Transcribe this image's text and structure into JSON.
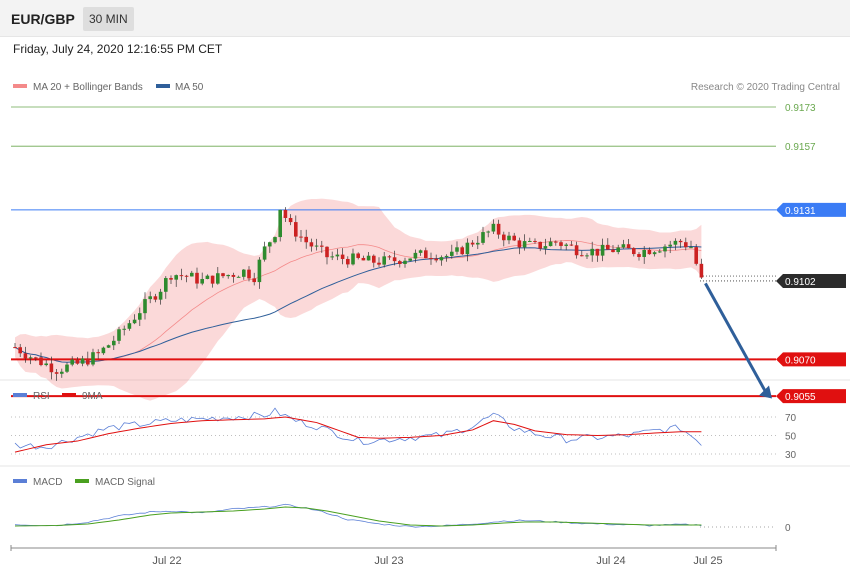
{
  "header": {
    "symbol": "EUR/GBP",
    "timeframe": "30 MIN"
  },
  "timestamp": "Friday, July 24, 2020 12:16:55 PM CET",
  "legend": {
    "bollinger_label": "MA 20 + Bollinger Bands",
    "ma50_label": "MA 50",
    "credit": "Research © 2020 Trading Central"
  },
  "colors": {
    "bollinger": "#f48a8a",
    "ma50": "#2f5f9a",
    "up_candle": "#2e8b2e",
    "down_candle": "#cc2222",
    "resistance_green": "#6aa84f",
    "level_blue": "#3b7cf5",
    "level_red": "#e01010",
    "arrow": "#2f5f9a",
    "rsi": "#5b7fd6",
    "rsi_ma": "#e01010",
    "macd": "#5b7fd6",
    "macd_signal": "#4aa020"
  },
  "chart_data": [
    {
      "type": "candlestick",
      "name": "price",
      "ylim": [
        9038,
        9188
      ],
      "levels": [
        {
          "value": "0.9173",
          "kind": "resistance-green"
        },
        {
          "value": "0.9157",
          "kind": "resistance-green"
        },
        {
          "value": "0.9131",
          "kind": "resistance-blue"
        },
        {
          "value": "0.9102",
          "kind": "current"
        },
        {
          "value": "0.9070",
          "kind": "support-red"
        },
        {
          "value": "0.9055",
          "kind": "support-red"
        }
      ],
      "close_path": [
        [
          0,
          9075
        ],
        [
          4,
          9070
        ],
        [
          8,
          9066
        ],
        [
          12,
          9068
        ],
        [
          16,
          9072
        ],
        [
          20,
          9080
        ],
        [
          24,
          9090
        ],
        [
          28,
          9099
        ],
        [
          30,
          9105
        ],
        [
          33,
          9104
        ],
        [
          36,
          9102
        ],
        [
          40,
          9104
        ],
        [
          44,
          9106
        ],
        [
          46,
          9104
        ],
        [
          48,
          9115
        ],
        [
          50,
          9122
        ],
        [
          51,
          9132
        ],
        [
          53,
          9124
        ],
        [
          56,
          9118
        ],
        [
          60,
          9112
        ],
        [
          64,
          9111
        ],
        [
          68,
          9110
        ],
        [
          72,
          9110
        ],
        [
          76,
          9112
        ],
        [
          80,
          9113
        ],
        [
          84,
          9112
        ],
        [
          88,
          9118
        ],
        [
          92,
          9123
        ],
        [
          96,
          9118
        ],
        [
          100,
          9116
        ],
        [
          104,
          9118
        ],
        [
          108,
          9115
        ],
        [
          112,
          9114
        ],
        [
          116,
          9115
        ],
        [
          120,
          9114
        ],
        [
          124,
          9116
        ],
        [
          128,
          9118
        ],
        [
          130,
          9116
        ],
        [
          132,
          9102
        ]
      ],
      "candle_count": 133,
      "x_ticks": [
        {
          "label": "Jul 22",
          "i": 31
        },
        {
          "label": "Jul 23",
          "i": 75
        },
        {
          "label": "Jul 24",
          "i": 120
        },
        {
          "label": "Jul 25",
          "i": 140
        }
      ],
      "forecast_arrow": {
        "from": "0.9102",
        "to": "0.9055"
      }
    },
    {
      "type": "line",
      "name": "rsi-panel",
      "legend": [
        "RSI",
        "9MA"
      ],
      "y_ticks": [
        "70",
        "50",
        "30"
      ],
      "ylim": [
        25,
        78
      ],
      "rsi": [
        [
          0,
          40
        ],
        [
          6,
          38
        ],
        [
          12,
          48
        ],
        [
          18,
          58
        ],
        [
          24,
          62
        ],
        [
          30,
          66
        ],
        [
          36,
          68
        ],
        [
          42,
          70
        ],
        [
          48,
          72
        ],
        [
          50,
          76
        ],
        [
          54,
          66
        ],
        [
          58,
          60
        ],
        [
          62,
          52
        ],
        [
          66,
          44
        ],
        [
          70,
          45
        ],
        [
          76,
          48
        ],
        [
          82,
          50
        ],
        [
          88,
          60
        ],
        [
          92,
          72
        ],
        [
          96,
          58
        ],
        [
          100,
          52
        ],
        [
          106,
          46
        ],
        [
          112,
          48
        ],
        [
          118,
          50
        ],
        [
          124,
          56
        ],
        [
          128,
          58
        ],
        [
          132,
          42
        ]
      ],
      "rsi_ma": [
        [
          0,
          32
        ],
        [
          6,
          40
        ],
        [
          12,
          44
        ],
        [
          18,
          52
        ],
        [
          24,
          58
        ],
        [
          30,
          63
        ],
        [
          36,
          66
        ],
        [
          42,
          67
        ],
        [
          48,
          68
        ],
        [
          52,
          70
        ],
        [
          58,
          64
        ],
        [
          62,
          56
        ],
        [
          66,
          48
        ],
        [
          70,
          47
        ],
        [
          76,
          48
        ],
        [
          82,
          50
        ],
        [
          88,
          56
        ],
        [
          92,
          66
        ],
        [
          96,
          62
        ],
        [
          100,
          55
        ],
        [
          106,
          51
        ],
        [
          112,
          50
        ],
        [
          118,
          51
        ],
        [
          124,
          53
        ],
        [
          128,
          54
        ],
        [
          130,
          54
        ]
      ]
    },
    {
      "type": "line",
      "name": "macd-panel",
      "legend": [
        "MACD",
        "MACD Signal"
      ],
      "y_ticks": [
        "0"
      ],
      "ylim": [
        -8,
        44
      ],
      "macd": [
        [
          0,
          5
        ],
        [
          8,
          3
        ],
        [
          14,
          10
        ],
        [
          20,
          22
        ],
        [
          26,
          30
        ],
        [
          30,
          32
        ],
        [
          36,
          28
        ],
        [
          42,
          36
        ],
        [
          48,
          40
        ],
        [
          52,
          44
        ],
        [
          56,
          38
        ],
        [
          60,
          28
        ],
        [
          64,
          15
        ],
        [
          70,
          6
        ],
        [
          76,
          1
        ],
        [
          82,
          2
        ],
        [
          88,
          6
        ],
        [
          94,
          12
        ],
        [
          98,
          13
        ],
        [
          104,
          10
        ],
        [
          110,
          7
        ],
        [
          116,
          5
        ],
        [
          122,
          3
        ],
        [
          128,
          5
        ],
        [
          132,
          4
        ]
      ],
      "macd_signal": [
        [
          0,
          2
        ],
        [
          8,
          3
        ],
        [
          14,
          6
        ],
        [
          20,
          14
        ],
        [
          26,
          24
        ],
        [
          30,
          28
        ],
        [
          36,
          30
        ],
        [
          42,
          32
        ],
        [
          48,
          36
        ],
        [
          52,
          40
        ],
        [
          56,
          38
        ],
        [
          60,
          32
        ],
        [
          64,
          24
        ],
        [
          70,
          12
        ],
        [
          76,
          4
        ],
        [
          82,
          2
        ],
        [
          88,
          4
        ],
        [
          94,
          8
        ],
        [
          98,
          10
        ],
        [
          104,
          10
        ],
        [
          110,
          8
        ],
        [
          116,
          6
        ],
        [
          122,
          4
        ],
        [
          128,
          4
        ],
        [
          132,
          4
        ]
      ]
    }
  ]
}
